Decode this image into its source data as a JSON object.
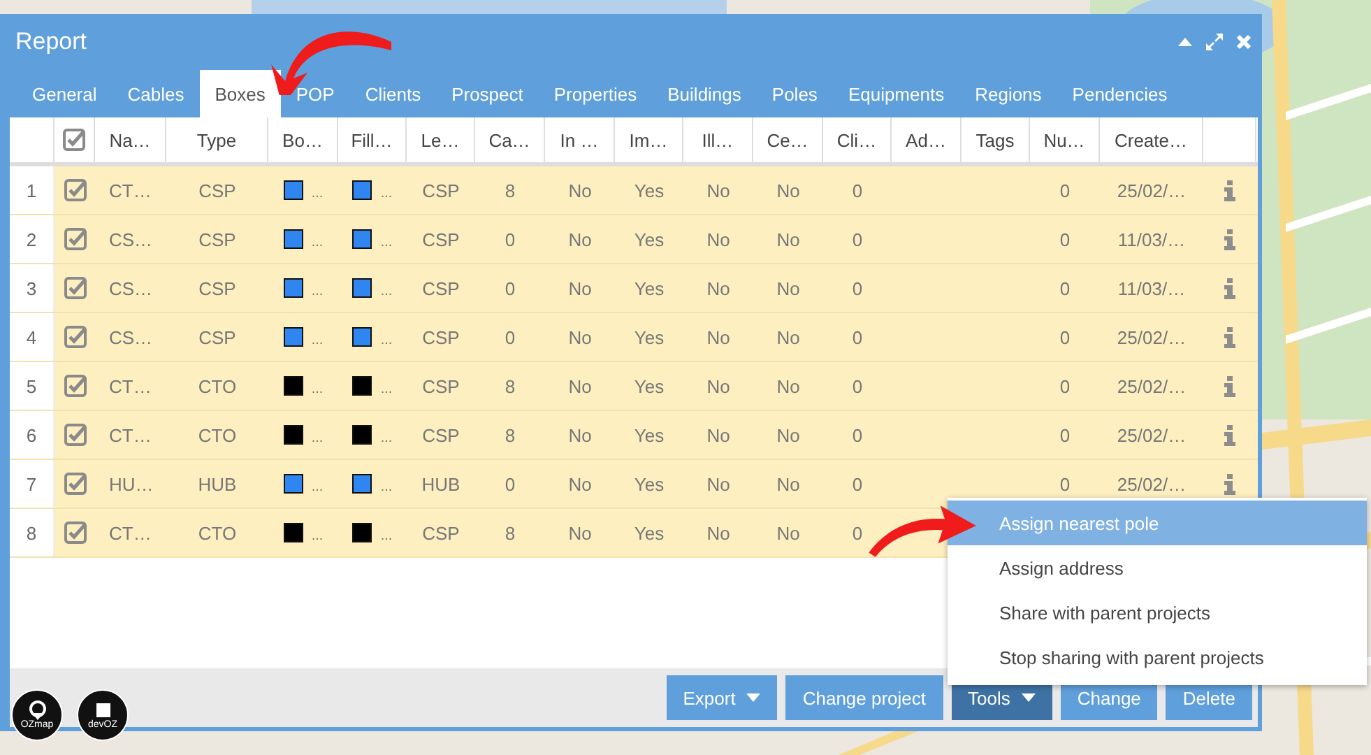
{
  "window": {
    "title": "Report"
  },
  "tabs": [
    {
      "label": "General",
      "selected": false
    },
    {
      "label": "Cables",
      "selected": false
    },
    {
      "label": "Boxes",
      "selected": true
    },
    {
      "label": "POP",
      "selected": false
    },
    {
      "label": "Clients",
      "selected": false
    },
    {
      "label": "Prospect",
      "selected": false
    },
    {
      "label": "Properties",
      "selected": false
    },
    {
      "label": "Buildings",
      "selected": false
    },
    {
      "label": "Poles",
      "selected": false
    },
    {
      "label": "Equipments",
      "selected": false
    },
    {
      "label": "Regions",
      "selected": false
    },
    {
      "label": "Pendencies",
      "selected": false
    }
  ],
  "table": {
    "all_checked": true,
    "columns": [
      "Na…",
      "Type",
      "Bo…",
      "Fill…",
      "Le…",
      "Ca…",
      "In …",
      "Im…",
      "Ill…",
      "Ce…",
      "Cli…",
      "Ad…",
      "Tags",
      "Nu…",
      "Create…"
    ],
    "rows": [
      {
        "number": "1",
        "checked": true,
        "info": true,
        "cells": [
          {
            "kind": "text",
            "text": "CT…"
          },
          {
            "kind": "text",
            "text": "CSP"
          },
          {
            "kind": "swatch",
            "color": "#2f86f0",
            "text": "..."
          },
          {
            "kind": "swatch",
            "color": "#2f86f0",
            "text": "..."
          },
          {
            "kind": "text",
            "text": "CSP"
          },
          {
            "kind": "text",
            "text": "8"
          },
          {
            "kind": "text",
            "text": "No"
          },
          {
            "kind": "text",
            "text": "Yes"
          },
          {
            "kind": "text",
            "text": "No"
          },
          {
            "kind": "text",
            "text": "No"
          },
          {
            "kind": "text",
            "text": "0"
          },
          {
            "kind": "empty"
          },
          {
            "kind": "empty"
          },
          {
            "kind": "text",
            "text": "0"
          },
          {
            "kind": "text",
            "text": "25/02/…"
          }
        ]
      },
      {
        "number": "2",
        "checked": true,
        "info": true,
        "cells": [
          {
            "kind": "text",
            "text": "CS…"
          },
          {
            "kind": "text",
            "text": "CSP"
          },
          {
            "kind": "swatch",
            "color": "#2f86f0",
            "text": "..."
          },
          {
            "kind": "swatch",
            "color": "#2f86f0",
            "text": "..."
          },
          {
            "kind": "text",
            "text": "CSP"
          },
          {
            "kind": "text",
            "text": "0"
          },
          {
            "kind": "text",
            "text": "No"
          },
          {
            "kind": "text",
            "text": "Yes"
          },
          {
            "kind": "text",
            "text": "No"
          },
          {
            "kind": "text",
            "text": "No"
          },
          {
            "kind": "text",
            "text": "0"
          },
          {
            "kind": "empty"
          },
          {
            "kind": "empty"
          },
          {
            "kind": "text",
            "text": "0"
          },
          {
            "kind": "text",
            "text": "11/03/…"
          }
        ]
      },
      {
        "number": "3",
        "checked": true,
        "info": true,
        "cells": [
          {
            "kind": "text",
            "text": "CS…"
          },
          {
            "kind": "text",
            "text": "CSP"
          },
          {
            "kind": "swatch",
            "color": "#2f86f0",
            "text": "..."
          },
          {
            "kind": "swatch",
            "color": "#2f86f0",
            "text": "..."
          },
          {
            "kind": "text",
            "text": "CSP"
          },
          {
            "kind": "text",
            "text": "0"
          },
          {
            "kind": "text",
            "text": "No"
          },
          {
            "kind": "text",
            "text": "Yes"
          },
          {
            "kind": "text",
            "text": "No"
          },
          {
            "kind": "text",
            "text": "No"
          },
          {
            "kind": "text",
            "text": "0"
          },
          {
            "kind": "empty"
          },
          {
            "kind": "empty"
          },
          {
            "kind": "text",
            "text": "0"
          },
          {
            "kind": "text",
            "text": "11/03/…"
          }
        ]
      },
      {
        "number": "4",
        "checked": true,
        "info": true,
        "cells": [
          {
            "kind": "text",
            "text": "CS…"
          },
          {
            "kind": "text",
            "text": "CSP"
          },
          {
            "kind": "swatch",
            "color": "#2f86f0",
            "text": "..."
          },
          {
            "kind": "swatch",
            "color": "#2f86f0",
            "text": "..."
          },
          {
            "kind": "text",
            "text": "CSP"
          },
          {
            "kind": "text",
            "text": "0"
          },
          {
            "kind": "text",
            "text": "No"
          },
          {
            "kind": "text",
            "text": "Yes"
          },
          {
            "kind": "text",
            "text": "No"
          },
          {
            "kind": "text",
            "text": "No"
          },
          {
            "kind": "text",
            "text": "0"
          },
          {
            "kind": "empty"
          },
          {
            "kind": "empty"
          },
          {
            "kind": "text",
            "text": "0"
          },
          {
            "kind": "text",
            "text": "25/02/…"
          }
        ]
      },
      {
        "number": "5",
        "checked": true,
        "info": true,
        "cells": [
          {
            "kind": "text",
            "text": "CT…"
          },
          {
            "kind": "text",
            "text": "CTO"
          },
          {
            "kind": "swatch",
            "color": "#000000",
            "text": "..."
          },
          {
            "kind": "swatch",
            "color": "#000000",
            "text": "..."
          },
          {
            "kind": "text",
            "text": "CSP"
          },
          {
            "kind": "text",
            "text": "8"
          },
          {
            "kind": "text",
            "text": "No"
          },
          {
            "kind": "text",
            "text": "Yes"
          },
          {
            "kind": "text",
            "text": "No"
          },
          {
            "kind": "text",
            "text": "No"
          },
          {
            "kind": "text",
            "text": "0"
          },
          {
            "kind": "empty"
          },
          {
            "kind": "empty"
          },
          {
            "kind": "text",
            "text": "0"
          },
          {
            "kind": "text",
            "text": "25/02/…"
          }
        ]
      },
      {
        "number": "6",
        "checked": true,
        "info": true,
        "cells": [
          {
            "kind": "text",
            "text": "CT…"
          },
          {
            "kind": "text",
            "text": "CTO"
          },
          {
            "kind": "swatch",
            "color": "#000000",
            "text": "..."
          },
          {
            "kind": "swatch",
            "color": "#000000",
            "text": "..."
          },
          {
            "kind": "text",
            "text": "CSP"
          },
          {
            "kind": "text",
            "text": "8"
          },
          {
            "kind": "text",
            "text": "No"
          },
          {
            "kind": "text",
            "text": "Yes"
          },
          {
            "kind": "text",
            "text": "No"
          },
          {
            "kind": "text",
            "text": "No"
          },
          {
            "kind": "text",
            "text": "0"
          },
          {
            "kind": "empty"
          },
          {
            "kind": "empty"
          },
          {
            "kind": "text",
            "text": "0"
          },
          {
            "kind": "text",
            "text": "25/02/…"
          }
        ]
      },
      {
        "number": "7",
        "checked": true,
        "info": true,
        "cells": [
          {
            "kind": "text",
            "text": "HU…"
          },
          {
            "kind": "text",
            "text": "HUB"
          },
          {
            "kind": "swatch",
            "color": "#2f86f0",
            "text": "..."
          },
          {
            "kind": "swatch",
            "color": "#2f86f0",
            "text": "..."
          },
          {
            "kind": "text",
            "text": "HUB"
          },
          {
            "kind": "text",
            "text": "0"
          },
          {
            "kind": "text",
            "text": "No"
          },
          {
            "kind": "text",
            "text": "Yes"
          },
          {
            "kind": "text",
            "text": "No"
          },
          {
            "kind": "text",
            "text": "No"
          },
          {
            "kind": "text",
            "text": "0"
          },
          {
            "kind": "empty"
          },
          {
            "kind": "empty"
          },
          {
            "kind": "text",
            "text": "0"
          },
          {
            "kind": "text",
            "text": "25/02/…"
          }
        ]
      },
      {
        "number": "8",
        "checked": true,
        "info": false,
        "cells": [
          {
            "kind": "text",
            "text": "CT…"
          },
          {
            "kind": "text",
            "text": "CTO"
          },
          {
            "kind": "swatch",
            "color": "#000000",
            "text": "..."
          },
          {
            "kind": "swatch",
            "color": "#000000",
            "text": "..."
          },
          {
            "kind": "text",
            "text": "CSP"
          },
          {
            "kind": "text",
            "text": "8"
          },
          {
            "kind": "text",
            "text": "No"
          },
          {
            "kind": "text",
            "text": "Yes"
          },
          {
            "kind": "text",
            "text": "No"
          },
          {
            "kind": "text",
            "text": "No"
          },
          {
            "kind": "text",
            "text": "0"
          },
          {
            "kind": "empty"
          },
          {
            "kind": "empty"
          },
          {
            "kind": "empty"
          },
          {
            "kind": "empty"
          }
        ]
      }
    ]
  },
  "buttons": [
    {
      "label": "Export",
      "dropdown": true,
      "pressed": false
    },
    {
      "label": "Change project",
      "dropdown": false,
      "pressed": false
    },
    {
      "label": "Tools",
      "dropdown": true,
      "pressed": true
    },
    {
      "label": "Change",
      "dropdown": false,
      "pressed": false
    },
    {
      "label": "Delete",
      "dropdown": false,
      "pressed": false
    }
  ],
  "tools_menu": [
    {
      "label": "Assign nearest pole",
      "selected": true
    },
    {
      "label": "Assign address",
      "selected": false
    },
    {
      "label": "Share with parent projects",
      "selected": false
    },
    {
      "label": "Stop sharing with parent projects",
      "selected": false
    }
  ],
  "logos": [
    {
      "label": "OZmap"
    },
    {
      "label": "devOZ"
    }
  ]
}
